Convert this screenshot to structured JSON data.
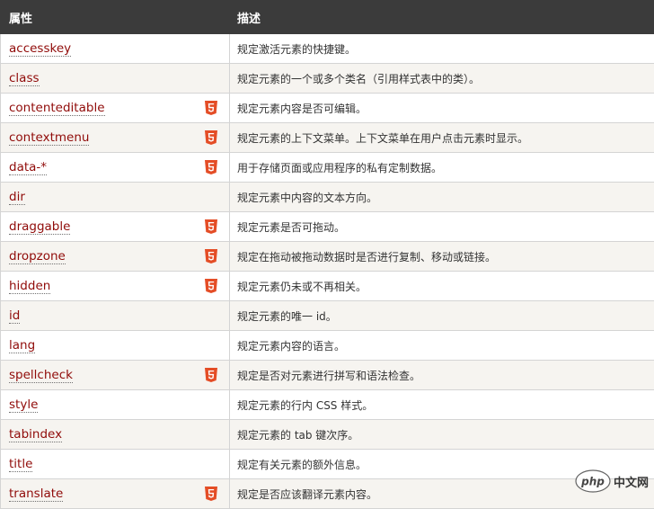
{
  "table": {
    "headers": {
      "name": "属性",
      "description": "描述"
    },
    "rows": [
      {
        "name": "accesskey",
        "html5": false,
        "description": "规定激活元素的快捷键。"
      },
      {
        "name": "class",
        "html5": false,
        "description": "规定元素的一个或多个类名（引用样式表中的类）。"
      },
      {
        "name": "contenteditable",
        "html5": true,
        "description": "规定元素内容是否可编辑。"
      },
      {
        "name": "contextmenu",
        "html5": true,
        "description": "规定元素的上下文菜单。上下文菜单在用户点击元素时显示。"
      },
      {
        "name": "data-*",
        "html5": true,
        "description": "用于存储页面或应用程序的私有定制数据。"
      },
      {
        "name": "dir",
        "html5": false,
        "description": "规定元素中内容的文本方向。"
      },
      {
        "name": "draggable",
        "html5": true,
        "description": "规定元素是否可拖动。"
      },
      {
        "name": "dropzone",
        "html5": true,
        "description": "规定在拖动被拖动数据时是否进行复制、移动或链接。"
      },
      {
        "name": "hidden",
        "html5": true,
        "description": "规定元素仍未或不再相关。"
      },
      {
        "name": "id",
        "html5": false,
        "description": "规定元素的唯一 id。"
      },
      {
        "name": "lang",
        "html5": false,
        "description": "规定元素内容的语言。"
      },
      {
        "name": "spellcheck",
        "html5": true,
        "description": "规定是否对元素进行拼写和语法检查。"
      },
      {
        "name": "style",
        "html5": false,
        "description": "规定元素的行内 CSS 样式。"
      },
      {
        "name": "tabindex",
        "html5": false,
        "description": "规定元素的 tab 键次序。"
      },
      {
        "name": "title",
        "html5": false,
        "description": "规定有关元素的额外信息。"
      },
      {
        "name": "translate",
        "html5": true,
        "description": "规定是否应该翻译元素内容。"
      }
    ]
  },
  "badge": {
    "icon": "html5-icon",
    "color": "#e44d26"
  },
  "watermark": {
    "logo_text": "php",
    "site_text": "中文网"
  }
}
